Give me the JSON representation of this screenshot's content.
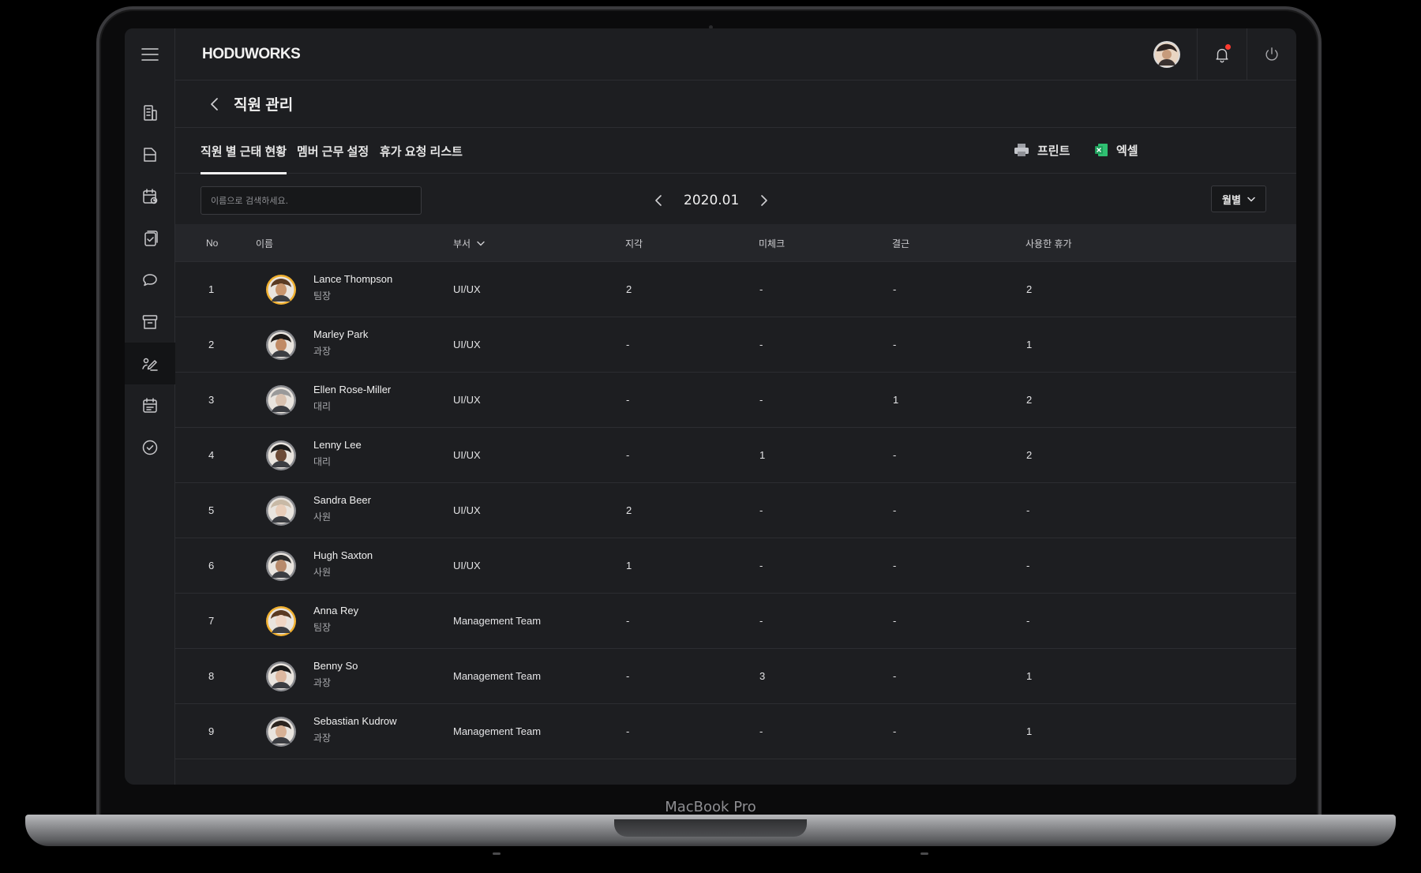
{
  "device": {
    "brand_label": "MacBook Pro"
  },
  "app": {
    "logo": "HODUWORKS",
    "page_title": "직원 관리"
  },
  "sidebar": {
    "items": [
      {
        "icon": "building-icon"
      },
      {
        "icon": "document-icon"
      },
      {
        "icon": "calendar-clock-icon"
      },
      {
        "icon": "clipboard-check-icon"
      },
      {
        "icon": "chat-icon"
      },
      {
        "icon": "archive-icon"
      },
      {
        "icon": "signature-icon",
        "active": true
      },
      {
        "icon": "schedule-icon"
      },
      {
        "icon": "check-circle-icon"
      }
    ]
  },
  "tabs": [
    {
      "label": "직원 별 근태 현황",
      "active": true
    },
    {
      "label": "멤버 근무 설정",
      "active": false
    },
    {
      "label": "휴가 요청 리스트",
      "active": false
    }
  ],
  "toolbar": {
    "print_label": "프린트",
    "excel_label": "엑셀"
  },
  "filters": {
    "search_placeholder": "이름으로 검색하세요.",
    "month": "2020.01",
    "period": "월별"
  },
  "table": {
    "headers": {
      "no": "No",
      "name": "이름",
      "dept": "부서",
      "late": "지각",
      "unchecked": "미체크",
      "absent": "결근",
      "leave": "사용한 휴가"
    },
    "rows": [
      {
        "no": "1",
        "name": "Lance Thompson",
        "title": "팀장",
        "dept": "UI/UX",
        "late": "2",
        "unchecked": "-",
        "absent": "-",
        "leave": "2"
      },
      {
        "no": "2",
        "name": "Marley Park",
        "title": "과장",
        "dept": "UI/UX",
        "late": "-",
        "unchecked": "-",
        "absent": "-",
        "leave": "1"
      },
      {
        "no": "3",
        "name": "Ellen Rose-Miller",
        "title": "대리",
        "dept": "UI/UX",
        "late": "-",
        "unchecked": "-",
        "absent": "1",
        "leave": "2"
      },
      {
        "no": "4",
        "name": "Lenny Lee",
        "title": "대리",
        "dept": "UI/UX",
        "late": "-",
        "unchecked": "1",
        "absent": "-",
        "leave": "2"
      },
      {
        "no": "5",
        "name": "Sandra Beer",
        "title": "사원",
        "dept": "UI/UX",
        "late": "2",
        "unchecked": "-",
        "absent": "-",
        "leave": "-"
      },
      {
        "no": "6",
        "name": "Hugh Saxton",
        "title": "사원",
        "dept": "UI/UX",
        "late": "1",
        "unchecked": "-",
        "absent": "-",
        "leave": "-"
      },
      {
        "no": "7",
        "name": "Anna Rey",
        "title": "팀장",
        "dept": "Management Team",
        "late": "-",
        "unchecked": "-",
        "absent": "-",
        "leave": "-"
      },
      {
        "no": "8",
        "name": "Benny So",
        "title": "과장",
        "dept": "Management Team",
        "late": "-",
        "unchecked": "3",
        "absent": "-",
        "leave": "1"
      },
      {
        "no": "9",
        "name": "Sebastian Kudrow",
        "title": "과장",
        "dept": "Management Team",
        "late": "-",
        "unchecked": "-",
        "absent": "-",
        "leave": "1"
      }
    ]
  },
  "colors": {
    "screen_bg": "#1d1e21",
    "header_bg": "#25262a",
    "notification_dot": "#ff3b30",
    "avatar_ring_leader": "#f0b030",
    "excel_green": "#1d9e5a"
  }
}
